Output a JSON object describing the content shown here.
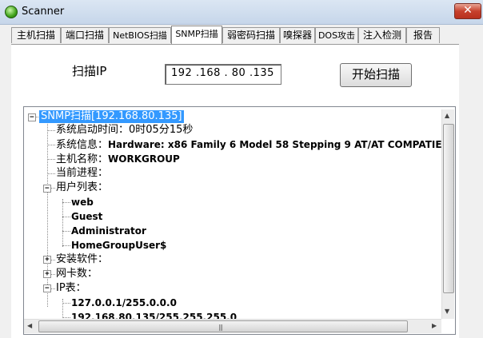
{
  "window": {
    "title": "Scanner",
    "close_label": "✕"
  },
  "tabs": [
    {
      "label": "主机扫描"
    },
    {
      "label": "端口扫描"
    },
    {
      "label": "NetBIOS扫描"
    },
    {
      "label": "SNMP扫描"
    },
    {
      "label": "弱密码扫描"
    },
    {
      "label": "嗅探器"
    },
    {
      "label": "DOS攻击"
    },
    {
      "label": "注入检测"
    },
    {
      "label": "报告"
    }
  ],
  "active_tab": "SNMP扫描",
  "scan": {
    "ip_label": "扫描IP",
    "ip_value": "192 .168 . 80  .135",
    "start_button": "开始扫描"
  },
  "tree": {
    "root": "SNMP扫描[192.168.80.135]",
    "items": [
      {
        "label": "系统启动时间：",
        "value": "0时05分15秒"
      },
      {
        "label": "系统信息：",
        "value": "Hardware: x86 Family 6 Model 58 Stepping 9 AT/AT COMPATIE"
      },
      {
        "label": "主机名称：",
        "value": "WORKGROUP"
      },
      {
        "label": "当前进程："
      },
      {
        "label": "用户列表：",
        "children": [
          "web",
          "Guest",
          "Administrator",
          "HomeGroupUser$"
        ]
      },
      {
        "label": "安装软件："
      },
      {
        "label": "网卡数："
      },
      {
        "label": "IP表：",
        "children": [
          "127.0.0.1/255.0.0.0",
          "192.168.80.135/255.255.255.0"
        ]
      }
    ]
  }
}
